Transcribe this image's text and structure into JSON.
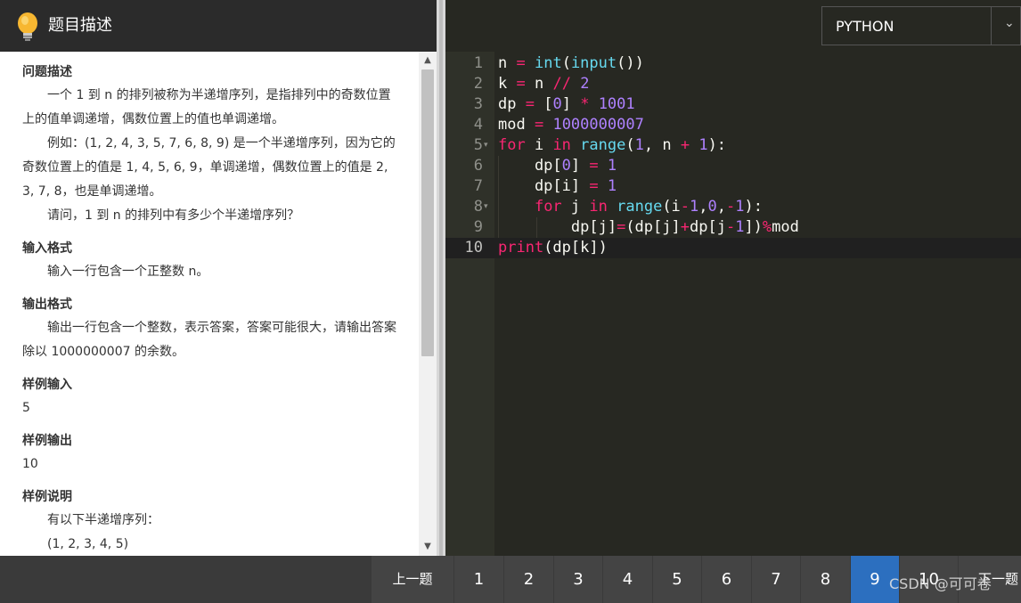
{
  "problem": {
    "header_title": "题目描述",
    "sections": {
      "desc_title": "问题描述",
      "desc_p1": "一个 1 到 n 的排列被称为半递增序列，是指排列中的奇数位置上的值单调递增，偶数位置上的值也单调递增。",
      "desc_p2": "例如：(1, 2, 4, 3, 5, 7, 6, 8, 9) 是一个半递增序列，因为它的奇数位置上的值是 1, 4, 5, 6, 9，单调递增，偶数位置上的值是 2, 3, 7, 8，也是单调递增。",
      "desc_p3": "请问，1 到 n 的排列中有多少个半递增序列？",
      "input_title": "输入格式",
      "input_p": "输入一行包含一个正整数 n。",
      "output_title": "输出格式",
      "output_p": "输出一行包含一个整数，表示答案，答案可能很大，请输出答案除以 1000000007 的余数。",
      "sample_in_title": "样例输入",
      "sample_in": "5",
      "sample_out_title": "样例输出",
      "sample_out": "10",
      "sample_explain_title": "样例说明",
      "sample_explain_p1": "有以下半递增序列：",
      "sample_explain_p2": "(1, 2, 3, 4, 5)"
    }
  },
  "editor": {
    "language": "PYTHON",
    "line_numbers": [
      "1",
      "2",
      "3",
      "4",
      "5",
      "6",
      "7",
      "8",
      "9",
      "10"
    ],
    "active_line": 10
  },
  "pagination": {
    "prev_label": "上一题",
    "pages": [
      "1",
      "2",
      "3",
      "4",
      "5",
      "6",
      "7",
      "8",
      "9",
      "10"
    ],
    "active_page": "9",
    "next_label": "下一题"
  },
  "watermark": "CSDN @可可卷",
  "colors": {
    "editor_bg": "#272822",
    "active_page": "#2c6fbf",
    "keyword": "#f92672",
    "builtin": "#66d9ef",
    "number": "#ae81ff"
  }
}
